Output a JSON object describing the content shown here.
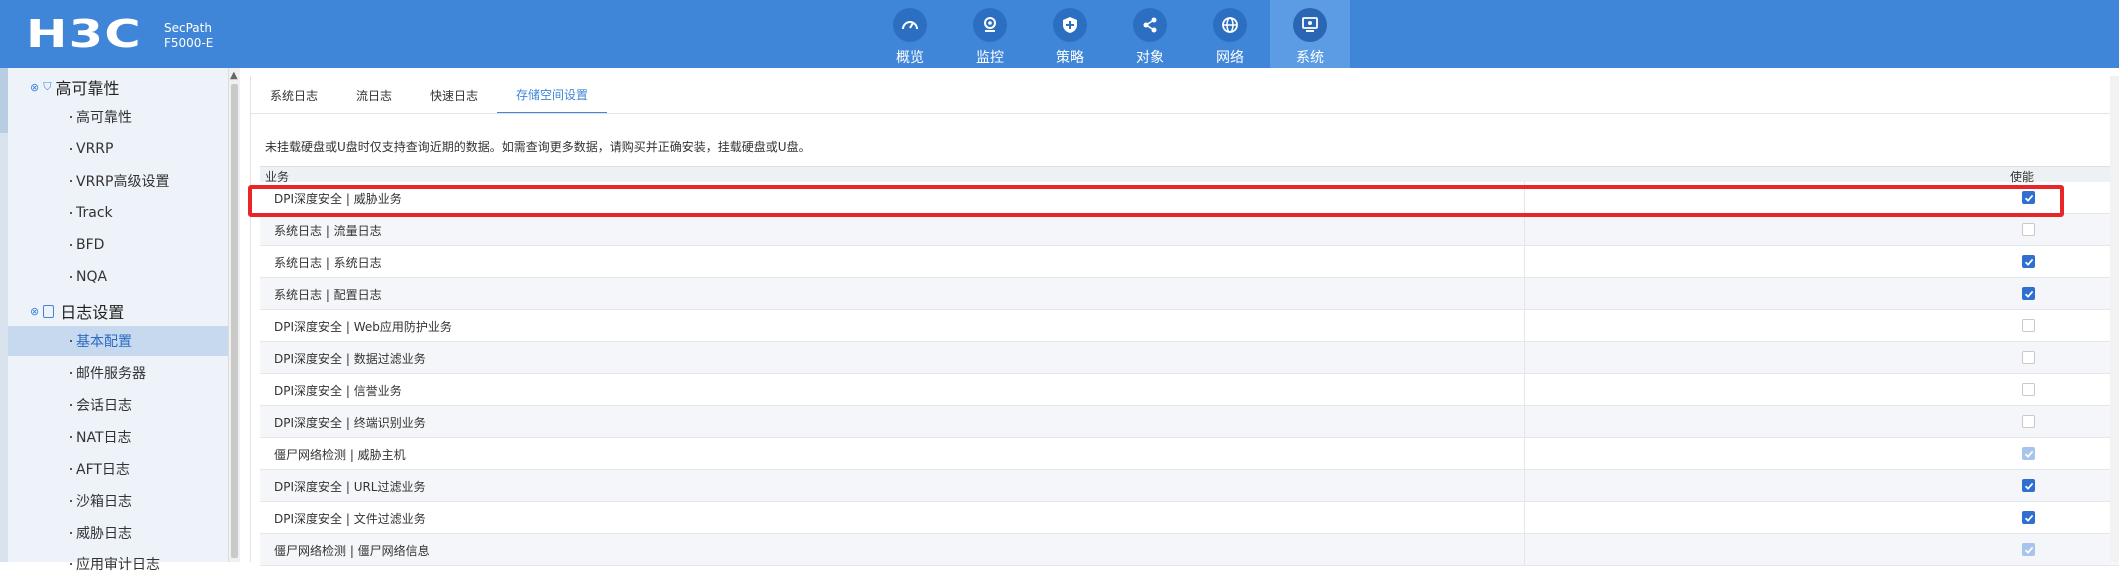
{
  "header": {
    "brand": "H3C",
    "product_line1": "SecPath",
    "product_line2": "F5000-E",
    "nav": [
      {
        "label": "概览",
        "icon": "gauge-icon",
        "active": false
      },
      {
        "label": "监控",
        "icon": "monitor-camera-icon",
        "active": false
      },
      {
        "label": "策略",
        "icon": "shield-icon",
        "active": false
      },
      {
        "label": "对象",
        "icon": "share-nodes-icon",
        "active": false
      },
      {
        "label": "网络",
        "icon": "globe-icon",
        "active": false
      },
      {
        "label": "系统",
        "icon": "screen-gear-icon",
        "active": true
      }
    ]
  },
  "sidebar": {
    "groups": [
      {
        "label": "高可靠性",
        "items": [
          "高可靠性",
          "VRRP",
          "VRRP高级设置",
          "Track",
          "BFD",
          "NQA"
        ]
      },
      {
        "label": "日志设置",
        "items": [
          "基本配置",
          "邮件服务器",
          "会话日志",
          "NAT日志",
          "AFT日志",
          "沙箱日志",
          "威胁日志",
          "应用审计日志"
        ]
      }
    ],
    "active_item": "基本配置"
  },
  "main": {
    "tabs": [
      "系统日志",
      "流日志",
      "快速日志",
      "存储空间设置"
    ],
    "active_tab": "存储空间设置",
    "notice": "未挂载硬盘或U盘时仅支持查询近期的数据。如需查询更多数据，请购买并正确安装，挂载硬盘或U盘。",
    "table": {
      "col_service": "业务",
      "col_enable": "使能",
      "rows": [
        {
          "name": "DPI深度安全 | 威胁业务",
          "enabled": true,
          "disabled": false
        },
        {
          "name": "系统日志 | 流量日志",
          "enabled": false,
          "disabled": false
        },
        {
          "name": "系统日志 | 系统日志",
          "enabled": true,
          "disabled": false
        },
        {
          "name": "系统日志 | 配置日志",
          "enabled": true,
          "disabled": false
        },
        {
          "name": "DPI深度安全 | Web应用防护业务",
          "enabled": false,
          "disabled": false
        },
        {
          "name": "DPI深度安全 | 数据过滤业务",
          "enabled": false,
          "disabled": false
        },
        {
          "name": "DPI深度安全 | 信誉业务",
          "enabled": false,
          "disabled": false
        },
        {
          "name": "DPI深度安全 | 终端识别业务",
          "enabled": false,
          "disabled": false
        },
        {
          "name": "僵尸网络检测 | 威胁主机",
          "enabled": true,
          "disabled": true
        },
        {
          "name": "DPI深度安全 | URL过滤业务",
          "enabled": true,
          "disabled": false
        },
        {
          "name": "DPI深度安全 | 文件过滤业务",
          "enabled": true,
          "disabled": false
        },
        {
          "name": "僵尸网络检测 | 僵尸网络信息",
          "enabled": true,
          "disabled": true
        }
      ]
    }
  },
  "colors": {
    "topbar": "#3f86d8",
    "accent": "#3f86d8",
    "checkbox_on": "#2e6fd1",
    "highlight": "#e8262a"
  }
}
